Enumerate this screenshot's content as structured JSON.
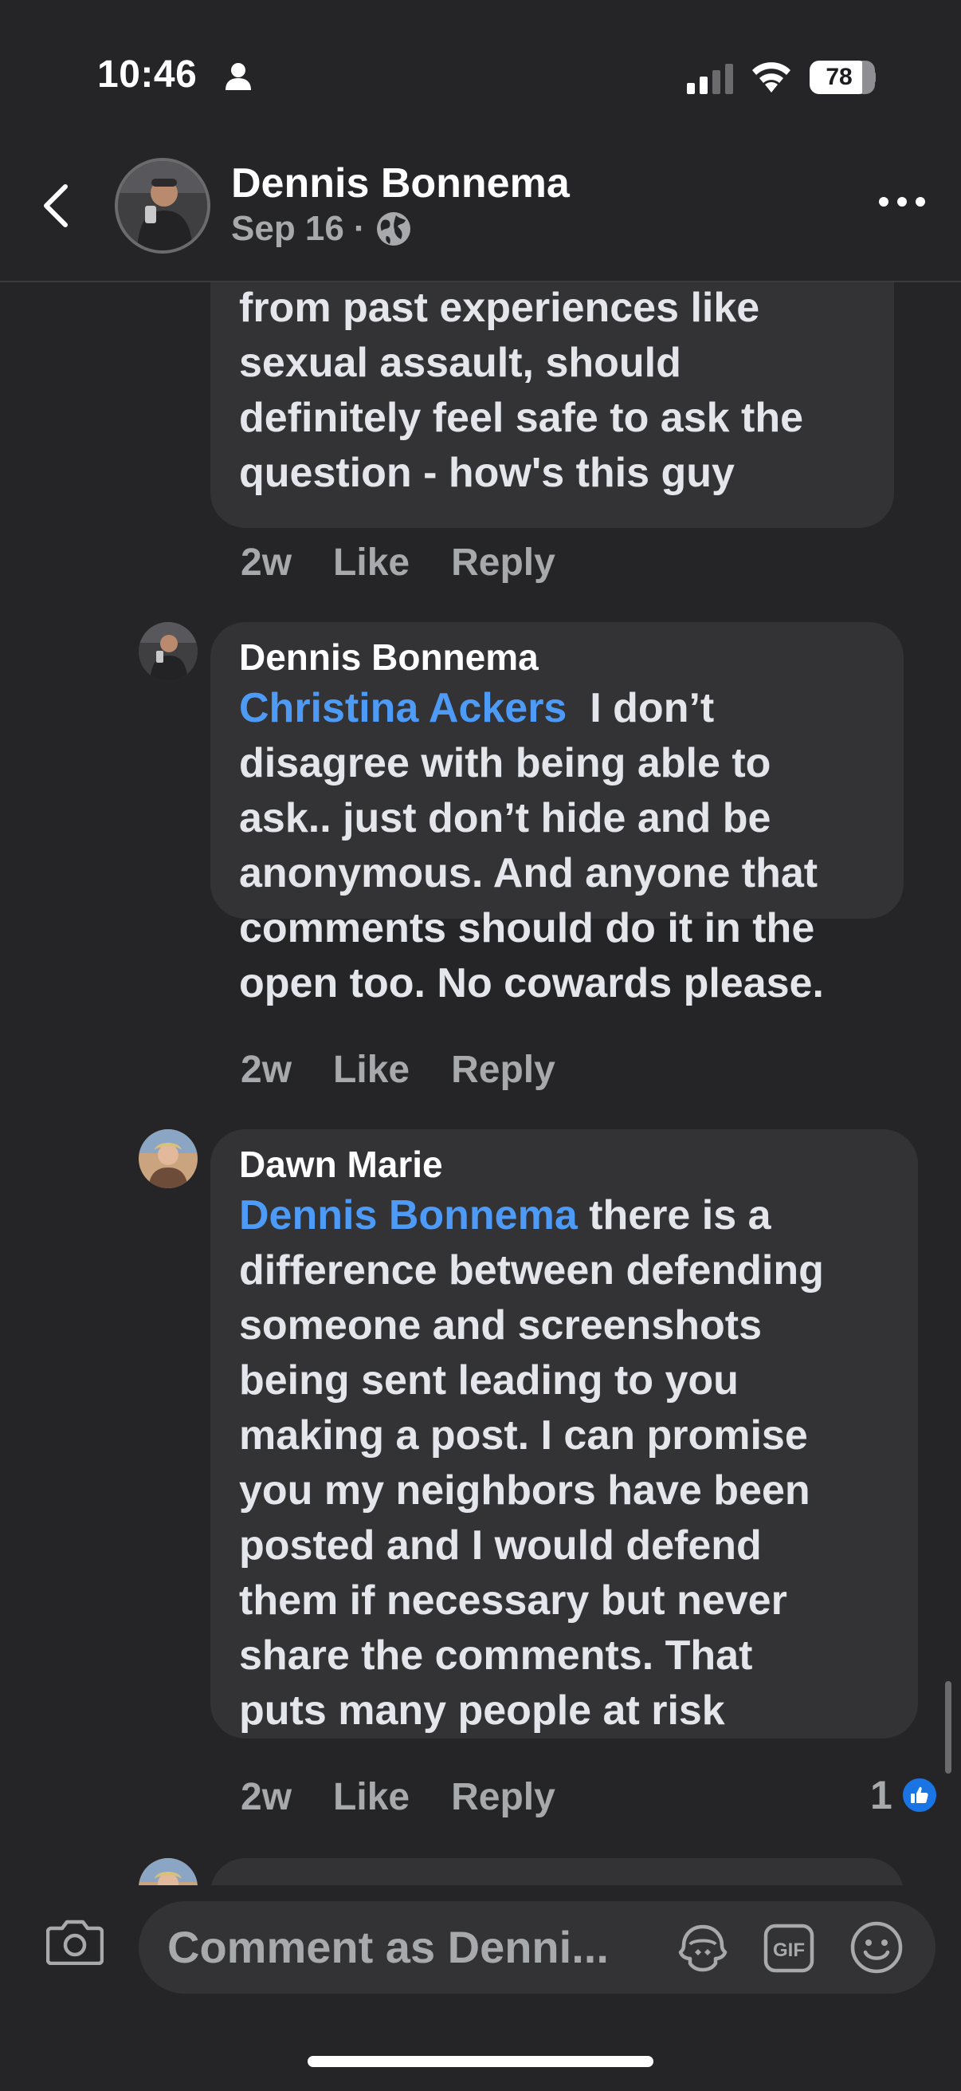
{
  "status_bar": {
    "time": "10:46",
    "battery": "78"
  },
  "header": {
    "name": "Dennis Bonnema",
    "date": "Sep 16",
    "separator": "·"
  },
  "comments": [
    {
      "author": "",
      "lines": [
        "from past experiences like",
        "sexual assault, should",
        "definitely feel safe to ask the",
        "question - how's this guy"
      ],
      "time": "2w",
      "like": "Like",
      "reply": "Reply"
    },
    {
      "author": "Dennis Bonnema",
      "mention": "Christina Ackers",
      "first_line_rest": "I don’t",
      "lines": [
        "disagree with being able to",
        "ask.. just don’t hide and be",
        "anonymous. And anyone that",
        "comments should do it in the",
        "open too. No cowards please."
      ],
      "time": "2w",
      "like": "Like",
      "reply": "Reply"
    },
    {
      "author": "Dawn Marie",
      "mention": "Dennis Bonnema",
      "first_line_rest": "there is a",
      "lines": [
        "difference between defending",
        "someone and screenshots",
        "being sent leading to you",
        "making a post. I can promise",
        "you my neighbors have been",
        "posted and I would defend",
        "them if necessary but never",
        "share the comments. That",
        "puts many people at risk"
      ],
      "time": "2w",
      "like": "Like",
      "reply": "Reply",
      "reaction_count": "1"
    }
  ],
  "composer": {
    "placeholder": "Comment as Denni..."
  },
  "colors": {
    "background": "#252527",
    "bubble": "#333335",
    "mention": "#4d9bf7",
    "like_badge": "#1b74e4"
  },
  "icons": [
    "person-icon",
    "signal-icon",
    "wifi-icon",
    "battery-icon",
    "back-icon",
    "globe-icon",
    "more-icon",
    "camera-icon",
    "avatar-sticker-icon",
    "gif-icon",
    "emoji-icon",
    "like-icon"
  ]
}
